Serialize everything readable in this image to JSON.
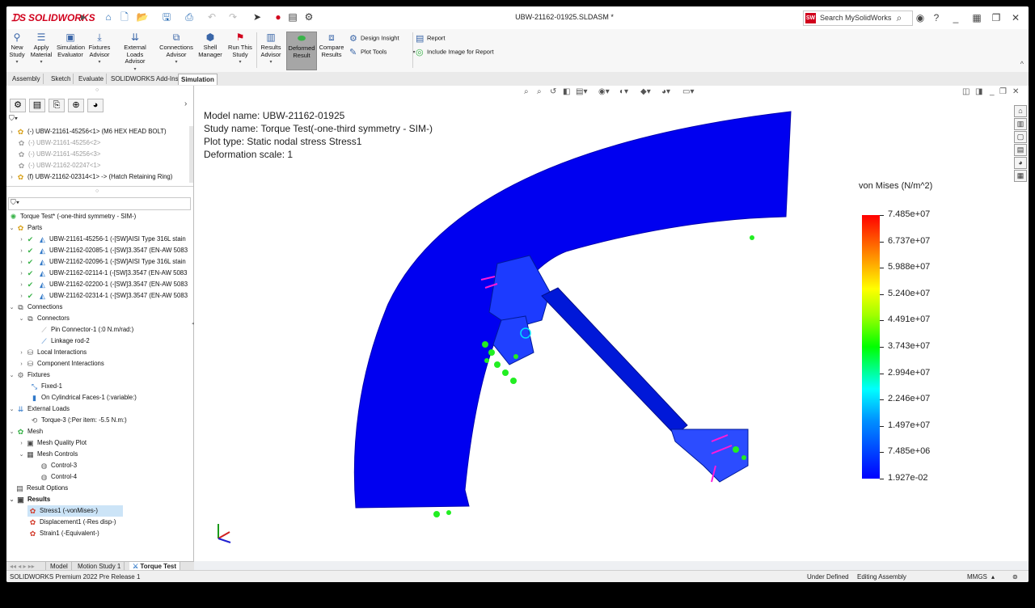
{
  "app": {
    "logo": "SOLIDWORKS",
    "doc_title": "UBW-21162-01925.SLDASM *"
  },
  "search": {
    "placeholder": "Search MySolidWorks"
  },
  "ribbon": {
    "buttons": [
      {
        "l1": "New",
        "l2": "Study"
      },
      {
        "l1": "Apply",
        "l2": "Material"
      },
      {
        "l1": "Simulation",
        "l2": "Evaluator"
      },
      {
        "l1": "Fixtures",
        "l2": "Advisor"
      },
      {
        "l1": "External Loads",
        "l2": "Advisor"
      },
      {
        "l1": "Connections",
        "l2": "Advisor"
      },
      {
        "l1": "Shell",
        "l2": "Manager"
      },
      {
        "l1": "Run This",
        "l2": "Study"
      },
      {
        "l1": "Results",
        "l2": "Advisor"
      },
      {
        "l1": "Deformed",
        "l2": "Result"
      },
      {
        "l1": "Compare",
        "l2": "Results"
      }
    ],
    "design_insight": "Design Insight",
    "plot_tools": "Plot Tools",
    "report": "Report",
    "include_image": "Include Image for Report"
  },
  "tabs": [
    "Assembly",
    "Sketch",
    "Evaluate",
    "SOLIDWORKS Add-Ins",
    "Simulation"
  ],
  "top_tree": [
    "(-) UBW-21161-45256<1> (M6 HEX HEAD BOLT)",
    "(-) UBW-21161-45256<2>",
    "(-) UBW-21161-45256<3>",
    "(-) UBW-21162-02247<1>",
    "(f) UBW-21162-02314<1> -> (Hatch Retaining Ring)"
  ],
  "sim_tree": {
    "study": "Torque Test* (-one-third symmetry - SIM-)",
    "parts": "Parts",
    "part_items": [
      "UBW-21161-45256-1 (-[SW]AISI Type 316L stain",
      "UBW-21162-02085-1 (-[SW]3.3547 (EN-AW 5083",
      "UBW-21162-02096-1 (-[SW]AISI Type 316L stain",
      "UBW-21162-02114-1 (-[SW]3.3547 (EN-AW 5083",
      "UBW-21162-02200-1 (-[SW]3.3547 (EN-AW 5083",
      "UBW-21162-02314-1 (-[SW]3.3547 (EN-AW 5083"
    ],
    "connections": "Connections",
    "connectors": "Connectors",
    "pin_connector": "Pin Connector-1 (:0 N.m/rad:)",
    "linkage": "Linkage rod-2",
    "local_interactions": "Local Interactions",
    "component_interactions": "Component Interactions",
    "fixtures": "Fixtures",
    "fixed": "Fixed-1",
    "on_cyl": "On Cylindrical Faces-1 (:variable:)",
    "external_loads": "External Loads",
    "torque": "Torque-3 (:Per item: -5.5 N.m:)",
    "mesh": "Mesh",
    "mesh_quality": "Mesh Quality Plot",
    "mesh_controls": "Mesh Controls",
    "control3": "Control-3",
    "control4": "Control-4",
    "result_options": "Result Options",
    "results": "Results",
    "stress": "Stress1 (-vonMises-)",
    "displacement": "Displacement1 (-Res disp-)",
    "strain": "Strain1 (-Equivalent-)"
  },
  "bottom_tabs": [
    "Model",
    "Motion Study 1",
    "Torque Test"
  ],
  "status": {
    "left": "SOLIDWORKS Premium 2022 Pre Release 1",
    "under_defined": "Under Defined",
    "editing": "Editing Assembly",
    "units": "MMGS"
  },
  "viewport_info": {
    "model": "Model name: UBW-21162-01925",
    "study": "Study name: Torque Test(-one-third symmetry - SIM-)",
    "plot": "Plot type: Static nodal stress Stress1",
    "deform": "Deformation scale: 1"
  },
  "legend": {
    "title": "von Mises (N/m^2)",
    "ticks": [
      "7.485e+07",
      "6.737e+07",
      "5.988e+07",
      "5.240e+07",
      "4.491e+07",
      "3.743e+07",
      "2.994e+07",
      "2.246e+07",
      "1.497e+07",
      "7.485e+06",
      "1.927e-02"
    ]
  },
  "colors": {
    "brand": "#d1001c",
    "mesh_blue": "#0000ff"
  }
}
